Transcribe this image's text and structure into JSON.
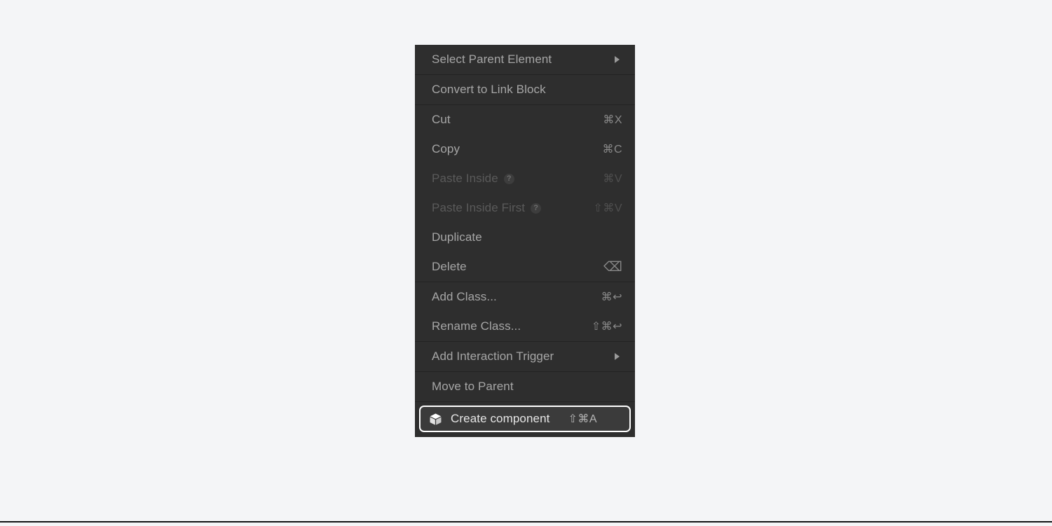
{
  "theme": {
    "page_background": "#f4f5f7",
    "menu_background": "#2e2e2e",
    "separator": "#232323",
    "text": "#a6a6a6",
    "text_disabled": "#5a5a5a",
    "highlight_background": "#3b3b3b",
    "highlight_ring": "#ffffff",
    "highlight_text": "#e6e6e6"
  },
  "context_menu": {
    "sections": [
      {
        "items": [
          {
            "label": "Select Parent Element",
            "shortcut": "",
            "submenu": true,
            "disabled": false,
            "help": false,
            "icon": ""
          }
        ]
      },
      {
        "items": [
          {
            "label": "Convert to Link Block",
            "shortcut": "",
            "submenu": false,
            "disabled": false,
            "help": false,
            "icon": ""
          }
        ]
      },
      {
        "items": [
          {
            "label": "Cut",
            "shortcut": "⌘X",
            "submenu": false,
            "disabled": false,
            "help": false,
            "icon": ""
          },
          {
            "label": "Copy",
            "shortcut": "⌘C",
            "submenu": false,
            "disabled": false,
            "help": false,
            "icon": ""
          },
          {
            "label": "Paste Inside",
            "shortcut": "⌘V",
            "submenu": false,
            "disabled": true,
            "help": true,
            "help_glyph": "?",
            "icon": ""
          },
          {
            "label": "Paste Inside First",
            "shortcut": "⇧⌘V",
            "submenu": false,
            "disabled": true,
            "help": true,
            "help_glyph": "?",
            "icon": ""
          },
          {
            "label": "Duplicate",
            "shortcut": "",
            "submenu": false,
            "disabled": false,
            "help": false,
            "icon": ""
          },
          {
            "label": "Delete",
            "shortcut": "⌫",
            "submenu": false,
            "disabled": false,
            "help": false,
            "icon": "backspace-icon"
          }
        ]
      },
      {
        "items": [
          {
            "label": "Add Class...",
            "shortcut": "⌘↩",
            "submenu": false,
            "disabled": false,
            "help": false,
            "icon": ""
          },
          {
            "label": "Rename Class...",
            "shortcut": "⇧⌘↩",
            "submenu": false,
            "disabled": false,
            "help": false,
            "icon": ""
          }
        ]
      },
      {
        "items": [
          {
            "label": "Add Interaction Trigger",
            "shortcut": "",
            "submenu": true,
            "disabled": false,
            "help": false,
            "icon": ""
          }
        ]
      },
      {
        "items": [
          {
            "label": "Move to Parent",
            "shortcut": "",
            "submenu": false,
            "disabled": false,
            "help": false,
            "icon": ""
          }
        ]
      }
    ],
    "highlighted_item": {
      "label": "Create component",
      "shortcut": "⇧⌘A",
      "icon": "cube-icon"
    }
  }
}
